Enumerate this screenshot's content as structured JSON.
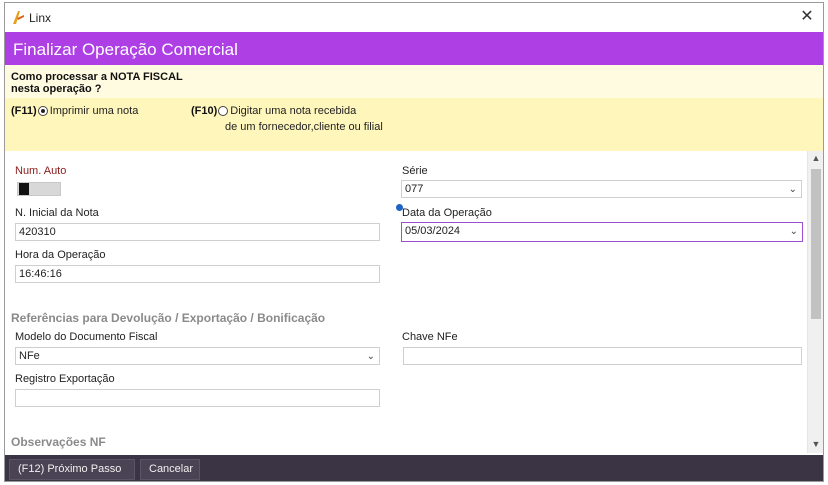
{
  "window": {
    "title": "Linx",
    "close_glyph": "✕"
  },
  "header": {
    "title": "Finalizar Operação Comercial"
  },
  "question": {
    "line1": "Como processar a NOTA FISCAL",
    "line2": "nesta operação ?",
    "option1": {
      "key": "(F11)",
      "label": "Imprimir uma nota",
      "selected": true
    },
    "option2": {
      "key": "(F10)",
      "label_line1": "Digitar uma nota recebida",
      "label_line2": "de um fornecedor,cliente ou filial",
      "selected": false
    }
  },
  "form": {
    "num_auto_label": "Num. Auto",
    "serie_label": "Série",
    "serie_value": "077",
    "n_inicial_label": "N. Inicial da Nota",
    "n_inicial_value": "420310",
    "data_operacao_label": "Data da Operação",
    "data_operacao_value": "05/03/2024",
    "hora_operacao_label": "Hora da Operação",
    "hora_operacao_value": "16:46:16",
    "section_referencias": "Referências para Devolução / Exportação / Bonificação",
    "modelo_label": "Modelo do Documento Fiscal",
    "modelo_value": "NFe",
    "chave_label": "Chave NFe",
    "chave_value": "",
    "registro_label": "Registro Exportação",
    "registro_value": "",
    "section_observacoes": "Observações NF"
  },
  "footer": {
    "next_button": "(F12) Próximo Passo",
    "cancel_button": "Cancelar"
  },
  "colors": {
    "header": "#ad3fe5",
    "footer": "#3b3444",
    "question_bg": "#fff6bc",
    "focus_border": "#9b4fd0"
  }
}
